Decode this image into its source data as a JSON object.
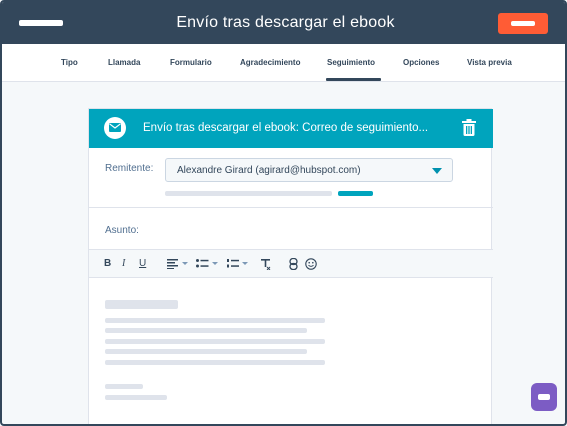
{
  "topbar": {
    "title": "Envío tras descargar el ebook",
    "action_button": "",
    "colors": {
      "bar": "#33475b",
      "action": "#ff5c35"
    }
  },
  "tabs": [
    {
      "label": "Tipo",
      "active": false
    },
    {
      "label": "Llamada",
      "active": false
    },
    {
      "label": "Formulario",
      "active": false
    },
    {
      "label": "Agradecimiento",
      "active": false
    },
    {
      "label": "Seguimiento",
      "active": true
    },
    {
      "label": "Opciones",
      "active": false
    },
    {
      "label": "Vista previa",
      "active": false
    }
  ],
  "card": {
    "title": "Envío tras descargar el ebook: Correo de seguimiento...",
    "header_icon": "mail-icon",
    "delete_icon": "trash-icon",
    "accent_color": "#00a4bd"
  },
  "sender": {
    "label": "Remitente:",
    "value": "Alexandre Girard (agirard@hubspot.com)"
  },
  "subject": {
    "label": "Asunto:",
    "value": ""
  },
  "toolbar": {
    "bold": "B",
    "italic": "I",
    "underline": "U",
    "icons": [
      "align-icon",
      "bullet-list-icon",
      "numbered-list-icon",
      "clear-format-icon",
      "link-icon",
      "emoji-icon"
    ]
  },
  "chat": {
    "icon": "chat-icon",
    "color": "#7c5cc4"
  }
}
